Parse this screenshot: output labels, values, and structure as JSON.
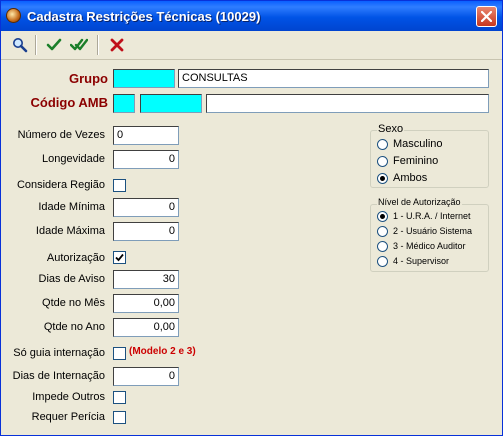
{
  "window": {
    "title": "Cadastra Restrições Técnicas (10029)",
    "close_label": "×"
  },
  "toolbar": {
    "search": "search-icon",
    "confirm": "check-icon",
    "confirm_all": "double-check-icon",
    "cancel": "x-icon"
  },
  "colors": {
    "title_bar": "#0053e6",
    "label_red": "#8b0000",
    "note_red": "#cc0000",
    "highlight_field": "#00ffff"
  },
  "form": {
    "grupo": {
      "label": "Grupo",
      "code": "",
      "description": "CONSULTAS"
    },
    "codigo_amb": {
      "label": "Código AMB",
      "part1": "",
      "part2": "",
      "description": ""
    },
    "numero_vezes": {
      "label": "Número de Vezes",
      "value": "0"
    },
    "longevidade": {
      "label": "Longevidade",
      "value": "0"
    },
    "considera_regiao": {
      "label": "Considera Região",
      "checked": false
    },
    "idade_minima": {
      "label": "Idade Mínima",
      "value": "0"
    },
    "idade_maxima": {
      "label": "Idade Máxima",
      "value": "0"
    },
    "autorizacao": {
      "label": "Autorização",
      "checked": true
    },
    "dias_aviso": {
      "label": "Dias de Aviso",
      "value": "30"
    },
    "qtde_mes": {
      "label": "Qtde no Mês",
      "value": "0,00"
    },
    "qtde_ano": {
      "label": "Qtde no Ano",
      "value": "0,00"
    },
    "so_guia": {
      "label": "Só guia internação",
      "checked": false,
      "note": "(Modelo 2 e 3)"
    },
    "dias_internacao": {
      "label": "Dias de Internação",
      "value": "0"
    },
    "impede_outros": {
      "label": "Impede Outros",
      "checked": false
    },
    "requer_pericia": {
      "label": "Requer Perícia",
      "checked": false
    }
  },
  "sexo": {
    "title": "Sexo",
    "options": [
      "Masculino",
      "Feminino",
      "Ambos"
    ],
    "selected": "Ambos"
  },
  "nivel": {
    "title": "Nível de Autorização",
    "options": [
      "1 - U.R.A. / Internet",
      "2 - Usuário Sistema",
      "3 - Médico Auditor",
      "4 - Supervisor"
    ],
    "selected": "1 - U.R.A. / Internet"
  }
}
